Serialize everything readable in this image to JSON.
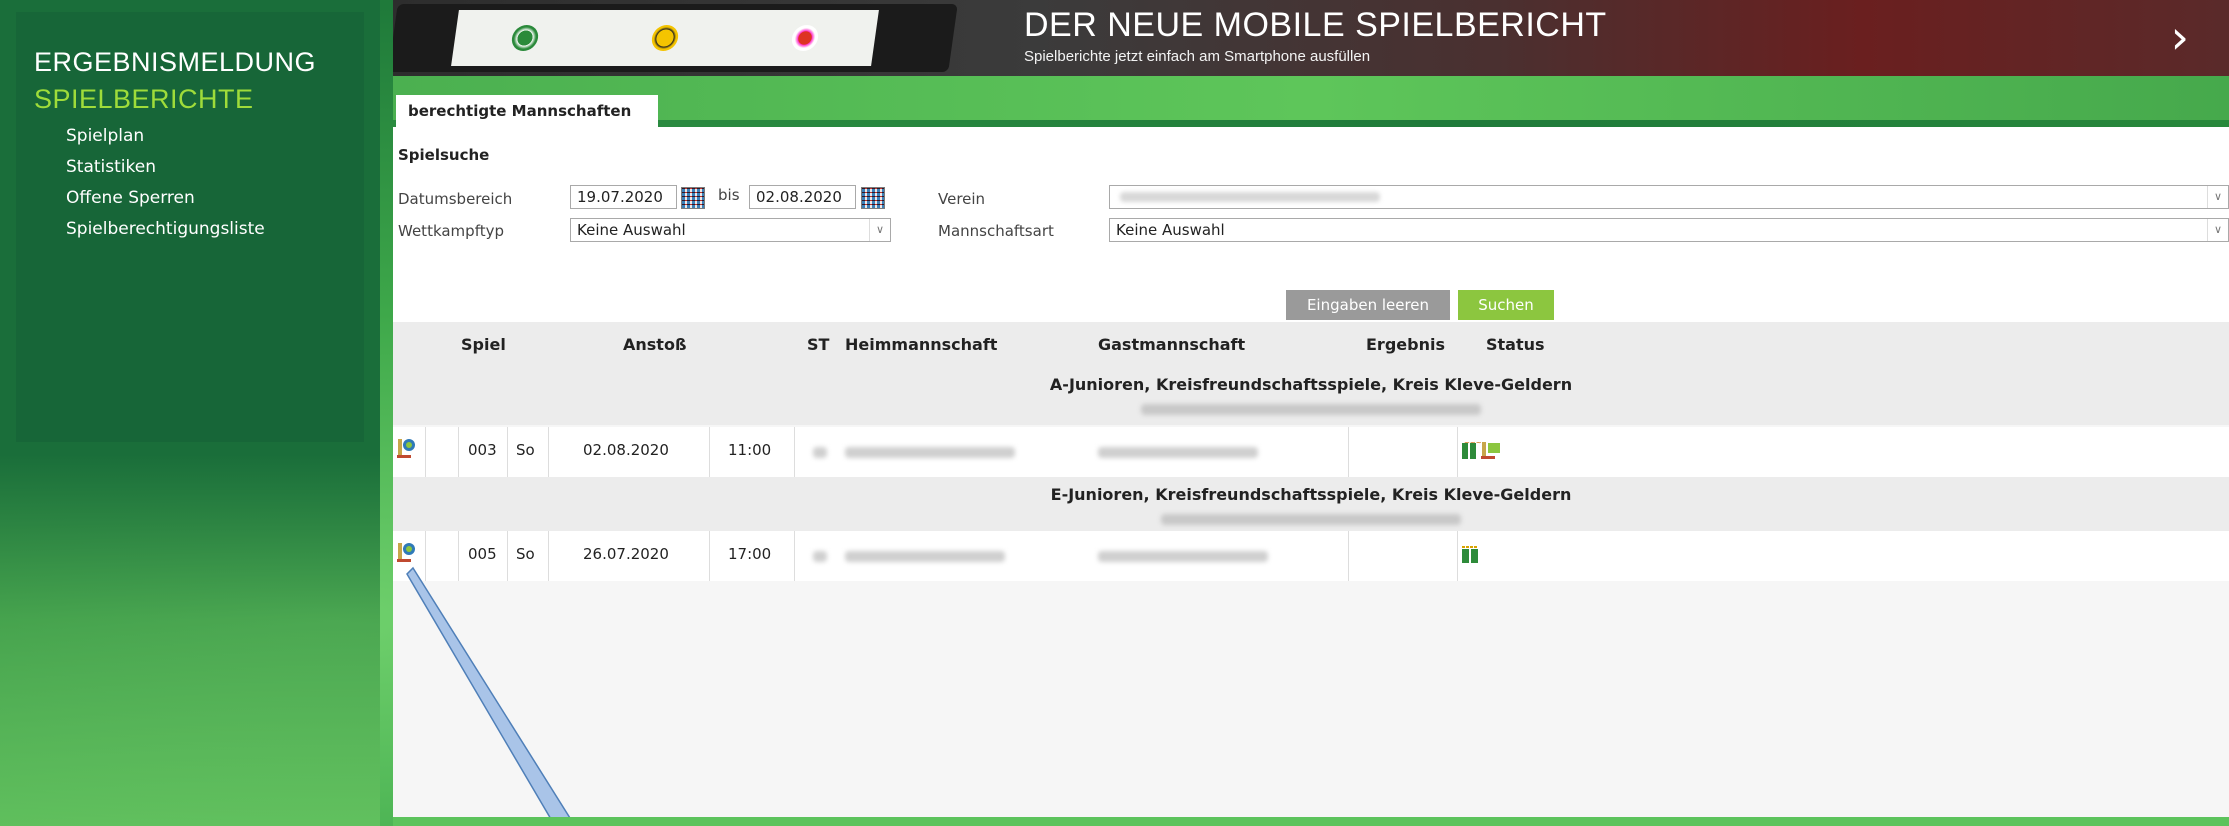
{
  "sidebar": {
    "heading1": "ERGEBNISMELDUNG",
    "heading2": "SPIELBERICHTE",
    "items": [
      {
        "label": "Spielplan"
      },
      {
        "label": "Statistiken"
      },
      {
        "label": "Offene Sperren"
      },
      {
        "label": "Spielberechtigungsliste"
      }
    ]
  },
  "banner": {
    "title": "DER NEUE MOBILE SPIELBERICHT",
    "subtitle": "Spielberichte jetzt einfach am Smartphone ausfüllen",
    "arrow": "›"
  },
  "tab": {
    "label": "berechtigte Mannschaften"
  },
  "search": {
    "title": "Spielsuche",
    "date_label": "Datumsbereich",
    "date_from": "19.07.2020",
    "bis_label": "bis",
    "date_to": "02.08.2020",
    "verein_label": "Verein",
    "wettkampf_label": "Wettkampftyp",
    "wettkampf_value": "Keine Auswahl",
    "mannschaftsart_label": "Mannschaftsart",
    "mannschaftsart_value": "Keine Auswahl",
    "clear_button": "Eingaben leeren",
    "search_button": "Suchen"
  },
  "table": {
    "headers": {
      "spiel": "Spiel",
      "anstoss": "Anstoß",
      "st": "ST",
      "heim": "Heimmannschaft",
      "gast": "Gastmannschaft",
      "ergebnis": "Ergebnis",
      "status": "Status"
    },
    "groups": [
      {
        "name": "A-Junioren, Kreisfreundschaftsspiele, Kreis Kleve-Geldern",
        "row": {
          "spiel": "003",
          "day": "So",
          "date": "02.08.2020",
          "time": "11:00"
        }
      },
      {
        "name": "E-Junioren, Kreisfreundschaftsspiele, Kreis Kleve-Geldern",
        "row": {
          "spiel": "005",
          "day": "So",
          "date": "26.07.2020",
          "time": "17:00"
        }
      }
    ]
  },
  "colors": {
    "sidebar_bg": "#176638",
    "accent_green": "#9fdc3a",
    "suchen_button": "#8cc63f",
    "clear_button": "#9a9a9a"
  }
}
